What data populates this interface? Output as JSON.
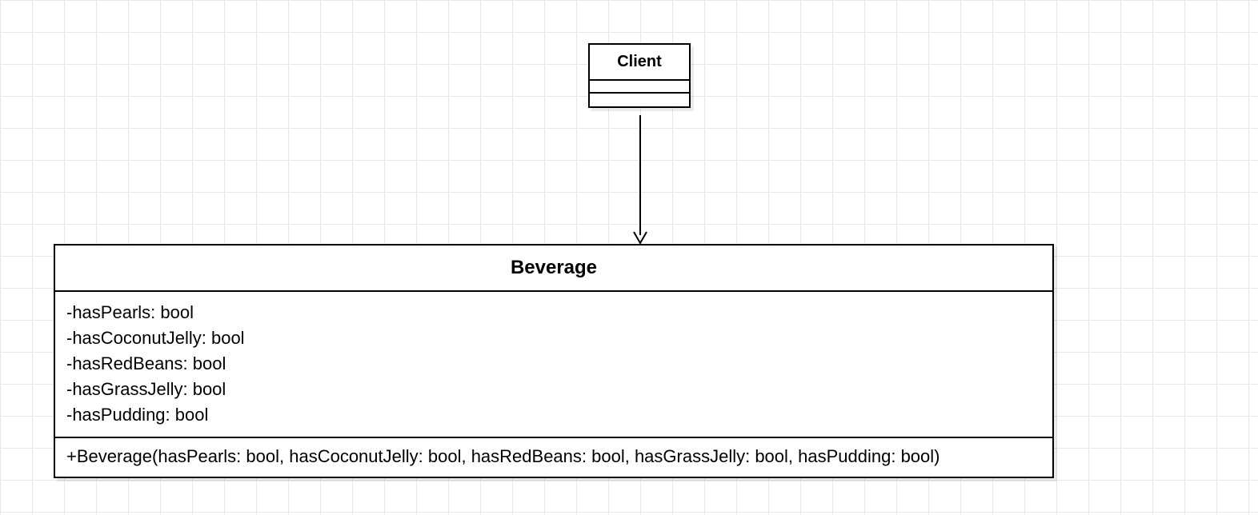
{
  "diagram": {
    "client": {
      "name": "Client",
      "attributes": [],
      "operations": []
    },
    "beverage": {
      "name": "Beverage",
      "attributes": [
        "-hasPearls: bool",
        "-hasCoconutJelly: bool",
        "-hasRedBeans: bool",
        "-hasGrassJelly: bool",
        "-hasPudding: bool"
      ],
      "operations": [
        "+Beverage(hasPearls: bool, hasCoconutJelly: bool, hasRedBeans: bool, hasGrassJelly: bool, hasPudding: bool)"
      ]
    },
    "relationship": {
      "from": "Client",
      "to": "Beverage",
      "type": "dependency-arrow"
    }
  }
}
